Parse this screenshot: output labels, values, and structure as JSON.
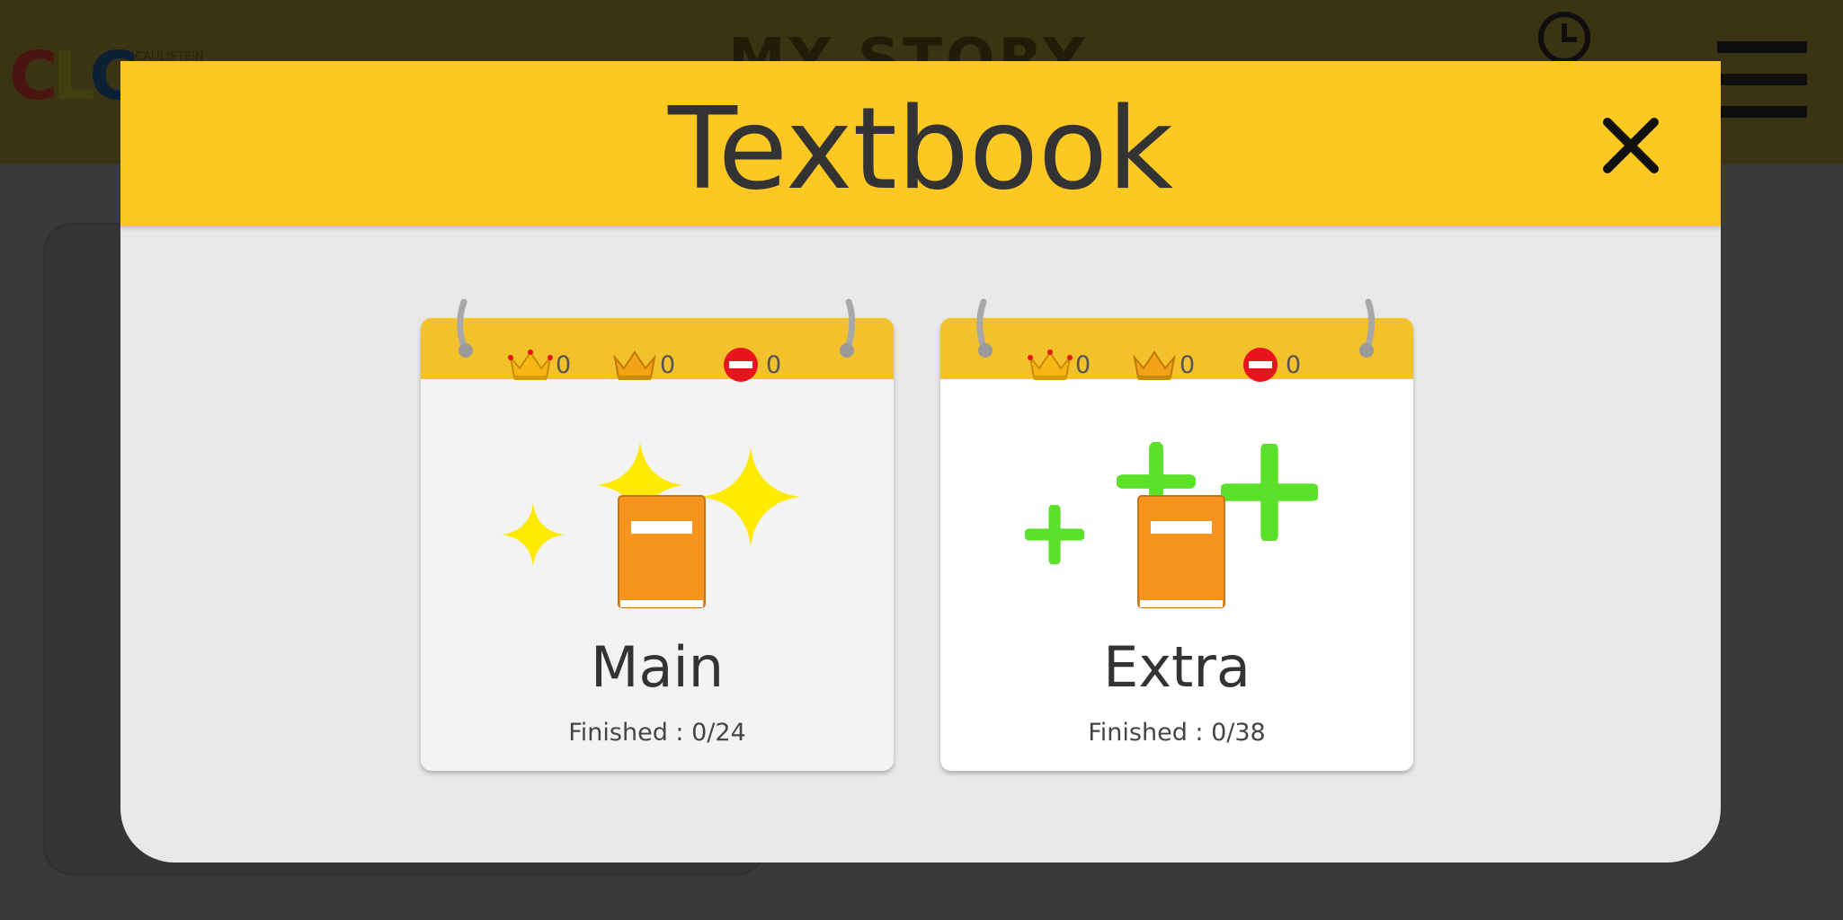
{
  "app": {
    "logo": "CLC",
    "logo_sub": "CAULISTEIN",
    "title": "MY STORY"
  },
  "modal": {
    "title": "Textbook",
    "close_icon": "close-icon"
  },
  "cards": [
    {
      "label": "Main",
      "progress": "Finished : 0/24",
      "gold_crown_count": "0",
      "silver_crown_count": "0",
      "blocked_count": "0",
      "decoration": "sparkles"
    },
    {
      "label": "Extra",
      "progress": "Finished : 0/38",
      "gold_crown_count": "0",
      "silver_crown_count": "0",
      "blocked_count": "0",
      "decoration": "plus-signs"
    }
  ],
  "colors": {
    "header_yellow": "#fec823",
    "card_top_yellow": "#f2c12b",
    "book_orange": "#f7941d",
    "sparkle_yellow": "#ffea00",
    "plus_green": "#5be12a",
    "blocked_red": "#e8141c"
  }
}
